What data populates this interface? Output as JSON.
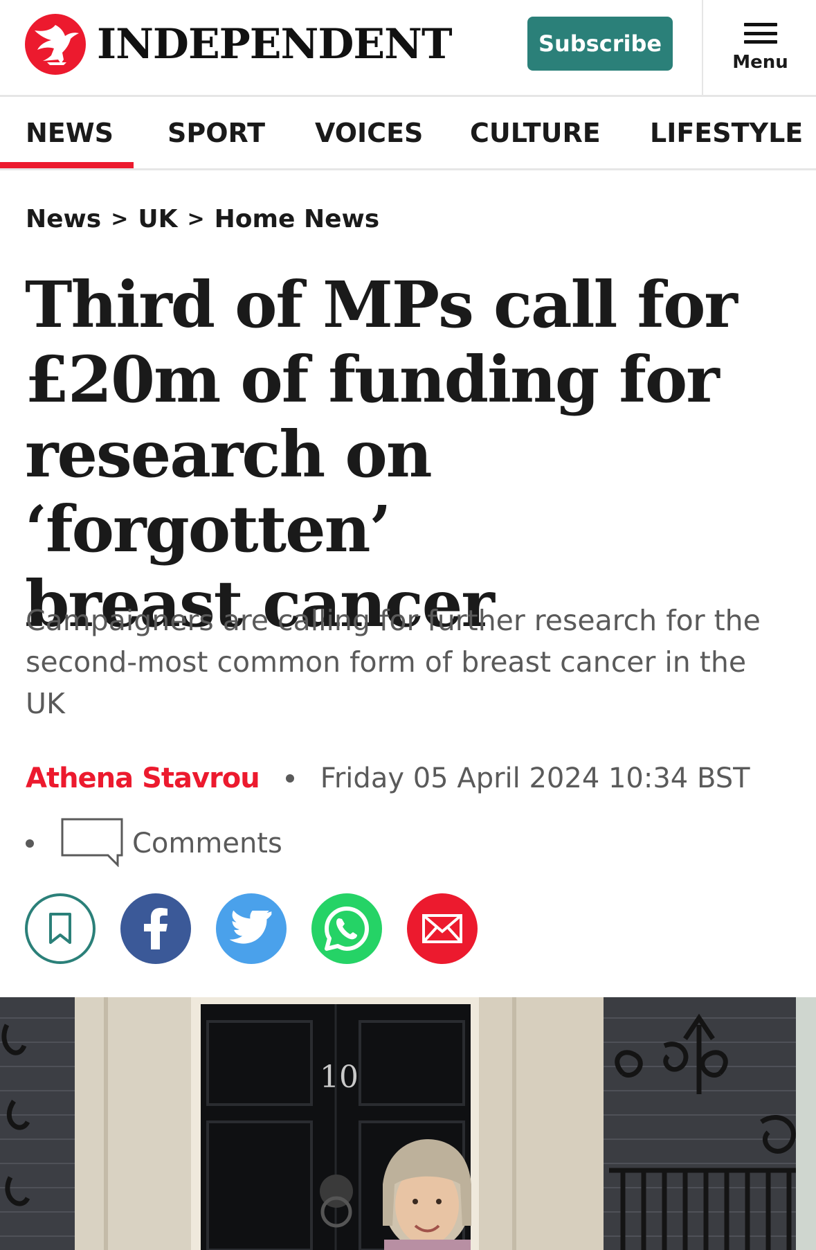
{
  "header": {
    "logo_text": "INDEPENDENT",
    "subscribe_label": "Subscribe",
    "menu_label": "Menu"
  },
  "nav": {
    "items": [
      {
        "label": "NEWS",
        "active": true
      },
      {
        "label": "SPORT",
        "active": false
      },
      {
        "label": "VOICES",
        "active": false
      },
      {
        "label": "CULTURE",
        "active": false
      },
      {
        "label": "LIFESTYLE",
        "active": false
      }
    ]
  },
  "breadcrumb": {
    "items": [
      "News",
      "UK",
      "Home News"
    ],
    "separator": ">"
  },
  "article": {
    "headline_lines": [
      "Third of MPs call for",
      "£20m of funding for",
      "research on ‘forgotten’",
      "breast cancer"
    ],
    "standfirst_lines": [
      "Campaigners are calling for further research for the",
      "second-most common form of breast cancer in the",
      "UK"
    ],
    "author": "Athena Stavrou",
    "date": "Friday 05 April 2024 10:34 BST",
    "comments_label": "Comments",
    "photo_door_number": "10"
  },
  "share": {
    "buttons": [
      "bookmark-icon",
      "facebook-icon",
      "twitter-icon",
      "whatsapp-icon",
      "email-icon"
    ]
  },
  "colors": {
    "brand_red": "#ec1a2e",
    "subscribe_teal": "#2b8079",
    "facebook": "#3b5998",
    "twitter": "#4aa1eb",
    "whatsapp": "#25d366"
  }
}
